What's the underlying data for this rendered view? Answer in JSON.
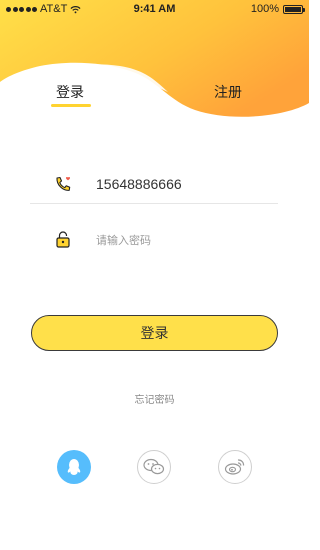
{
  "status_bar": {
    "carrier": "AT&T",
    "time": "9:41 AM",
    "battery": "100%"
  },
  "tabs": {
    "login": "登录",
    "register": "注册",
    "active": "login"
  },
  "form": {
    "phone_value": "15648886666",
    "password_placeholder": "请输入密码",
    "login_button": "登录",
    "forgot_password": "忘记密码"
  },
  "icons": [
    "phone-heart-icon",
    "lock-icon",
    "qq-icon",
    "wechat-icon",
    "weibo-icon"
  ],
  "colors": {
    "accent_yellow": "#ffe04a",
    "header_gradient_start": "#ffd84a",
    "header_gradient_end": "#ffa53a",
    "qq_blue": "#56bdfc",
    "heart_red": "#f05a4a"
  }
}
